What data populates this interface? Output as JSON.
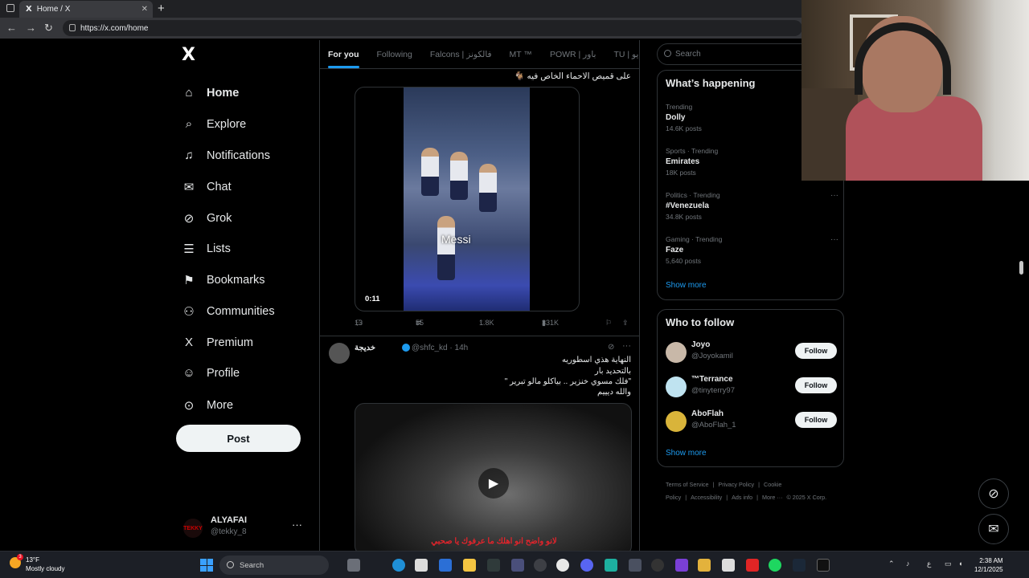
{
  "browser": {
    "tab_title": "Home / X",
    "tab_logo": "X",
    "tab_close": "✕",
    "new_tab": "+",
    "url": "https://x.com/home"
  },
  "leftnav": {
    "logo": "X",
    "items": [
      {
        "label": "Home",
        "icon": "home-icon",
        "glyph": "⌂"
      },
      {
        "label": "Explore",
        "icon": "search-icon",
        "glyph": "⌕"
      },
      {
        "label": "Notifications",
        "icon": "bell-icon",
        "glyph": "♫"
      },
      {
        "label": "Chat",
        "icon": "envelope-icon",
        "glyph": "✉"
      },
      {
        "label": "Grok",
        "icon": "grok-icon",
        "glyph": "⊘"
      },
      {
        "label": "Lists",
        "icon": "list-icon",
        "glyph": "☰"
      },
      {
        "label": "Bookmarks",
        "icon": "bookmark-icon",
        "glyph": "⚑"
      },
      {
        "label": "Communities",
        "icon": "people-icon",
        "glyph": "⚇"
      },
      {
        "label": "Premium",
        "icon": "x-premium-icon",
        "glyph": "X"
      },
      {
        "label": "Profile",
        "icon": "person-icon",
        "glyph": "☺"
      },
      {
        "label": "More",
        "icon": "more-circle-icon",
        "glyph": "⊙"
      }
    ],
    "post_button": "Post",
    "account": {
      "name": "ALYAFAI",
      "handle": "@tekky_8",
      "avatar_text": "TEKKY",
      "more": "···"
    }
  },
  "feed": {
    "tabs": [
      "For you",
      "Following",
      "Falcons | فالكونز",
      "MT ™",
      "POWR | باور",
      "TU | تي يو"
    ],
    "tweet1": {
      "caption": "على قميص الاحماء الخاص فيه 🐐",
      "video_label": "Messi",
      "video_time": "0:11",
      "replies": "13",
      "reposts": "55",
      "likes": "1.8K",
      "views": "331K"
    },
    "tweet2": {
      "name": "خديجة",
      "handle": "@shfc_kd",
      "time": "14h",
      "lines": [
        "النهاية هذي اسطوريه",
        "بالتحديد بار",
        "\"فلك مسوي خنزير .. بياكلو مالو تبرير \"",
        "والله ديييم"
      ],
      "video_subtitle": "لانو واضح انو اهلك ما عرفوك يا صحبي"
    }
  },
  "sidebar": {
    "search_placeholder": "Search",
    "happening": {
      "title": "What’s happening",
      "trends": [
        {
          "context": "Trending",
          "topic": "Dolly",
          "posts": "14.6K posts",
          "has_menu": false
        },
        {
          "context": "Sports · Trending",
          "topic": "Emirates",
          "posts": "18K posts",
          "has_menu": false
        },
        {
          "context": "Politics · Trending",
          "topic": "#Venezuela",
          "posts": "34.8K posts",
          "has_menu": true
        },
        {
          "context": "Gaming · Trending",
          "topic": "Faze",
          "posts": "5,640 posts",
          "has_menu": true
        }
      ],
      "show_more": "Show more"
    },
    "who_to_follow": {
      "title": "Who to follow",
      "users": [
        {
          "name": "Joyo",
          "handle": "@Joyokamil",
          "button": "Follow",
          "avatar_color": "#c8b8a8"
        },
        {
          "name": "™Terrance",
          "handle": "@tinyterry97",
          "button": "Follow",
          "avatar_color": "#bfe3f0"
        },
        {
          "name": "AboFlah",
          "handle": "@AboFlah_1",
          "button": "Follow",
          "avatar_color": "#d9b43a"
        }
      ],
      "show_more": "Show more"
    },
    "footer": [
      "Terms of Service",
      "|",
      "Privacy Policy",
      "|",
      "Cookie Policy",
      "|",
      "Accessibility",
      "|",
      "Ads info",
      "|",
      "More ···",
      "© 2025 X Corp."
    ]
  },
  "taskbar": {
    "weather_temp": "13°F",
    "weather_desc": "Mostly cloudy",
    "weather_badge": "3",
    "search": "Search",
    "time": "2:38 AM",
    "date": "12/1/2025",
    "lang": "ع"
  }
}
